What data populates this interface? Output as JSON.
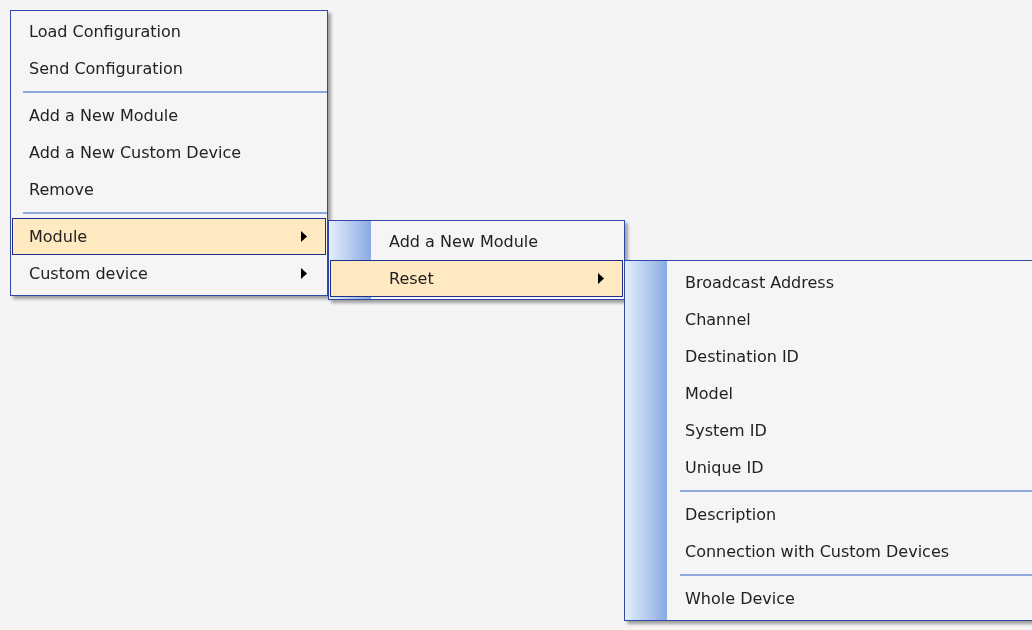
{
  "menus": [
    {
      "items": [
        {
          "kind": "item",
          "label": "Load Configuration",
          "submenu": false,
          "selected": false
        },
        {
          "kind": "item",
          "label": "Send Configuration",
          "submenu": false,
          "selected": false
        },
        {
          "kind": "separator"
        },
        {
          "kind": "item",
          "label": "Add a New Module",
          "submenu": false,
          "selected": false
        },
        {
          "kind": "item",
          "label": "Add a New Custom Device",
          "submenu": false,
          "selected": false
        },
        {
          "kind": "item",
          "label": "Remove",
          "submenu": false,
          "selected": false
        },
        {
          "kind": "separator"
        },
        {
          "kind": "item",
          "label": "Module",
          "submenu": true,
          "selected": true
        },
        {
          "kind": "item",
          "label": "Custom device",
          "submenu": true,
          "selected": false
        }
      ]
    },
    {
      "items": [
        {
          "kind": "item",
          "label": "Add a New Module",
          "submenu": false,
          "selected": false
        },
        {
          "kind": "item",
          "label": "Reset",
          "submenu": true,
          "selected": true
        }
      ]
    },
    {
      "items": [
        {
          "kind": "item",
          "label": "Broadcast Address",
          "selected": false
        },
        {
          "kind": "item",
          "label": "Channel",
          "selected": false
        },
        {
          "kind": "item",
          "label": "Destination ID",
          "selected": false
        },
        {
          "kind": "item",
          "label": "Model",
          "selected": false
        },
        {
          "kind": "item",
          "label": "System ID",
          "selected": false
        },
        {
          "kind": "item",
          "label": "Unique ID",
          "selected": false
        },
        {
          "kind": "separator"
        },
        {
          "kind": "item",
          "label": "Description",
          "selected": false
        },
        {
          "kind": "item",
          "label": "Connection with Custom Devices",
          "selected": false
        },
        {
          "kind": "separator"
        },
        {
          "kind": "item",
          "label": "Whole Device",
          "selected": false
        }
      ]
    }
  ]
}
